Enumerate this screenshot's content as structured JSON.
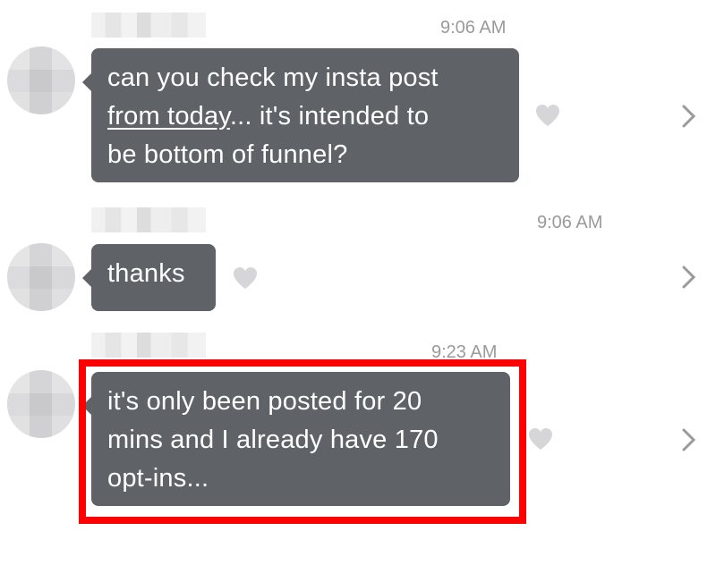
{
  "messages": [
    {
      "time": "9:06 AM",
      "text_before_link": "can you check my insta post",
      "link": "from today",
      "text_after_link": "... it's intended to",
      "line3": "be bottom of funnel?"
    },
    {
      "time": "9:06 AM",
      "text": "thanks"
    },
    {
      "time": "9:23 AM",
      "lines": [
        "it's only been posted for 20",
        "mins and I already have 170",
        "opt-ins..."
      ]
    }
  ],
  "icons": {
    "heart": "heart-icon",
    "chevron": "chevron-right-icon"
  },
  "colors": {
    "bubble": "#5f6368",
    "highlight": "#ff0000",
    "timestamp": "#9a9a9c"
  }
}
